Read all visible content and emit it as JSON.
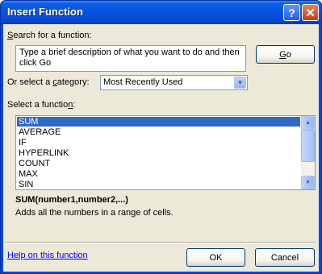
{
  "window": {
    "title": "Insert Function",
    "help_button": "?",
    "close_button": "✕"
  },
  "search": {
    "label_prefix": "",
    "label_accel": "S",
    "label_rest": "earch for a function:",
    "value": "Type a brief description of what you want to do and then click Go",
    "go_label_accel": "G",
    "go_label_rest": "o"
  },
  "category": {
    "label_prefix": "Or select a ",
    "label_accel": "c",
    "label_rest": "ategory:",
    "selected": "Most Recently Used"
  },
  "functions": {
    "label_prefix": "Select a functio",
    "label_accel": "n",
    "label_rest": ":",
    "items": [
      "SUM",
      "AVERAGE",
      "IF",
      "HYPERLINK",
      "COUNT",
      "MAX",
      "SIN"
    ],
    "selected_index": 0
  },
  "details": {
    "signature": "SUM(number1,number2,...)",
    "description": "Adds all the numbers in a range of cells."
  },
  "footer": {
    "help_link": "Help on this function",
    "ok_label": "OK",
    "cancel_label": "Cancel"
  },
  "colors": {
    "title_bar": "#0a52de",
    "selection": "#316ac5",
    "dialog_face": "#ece9d8",
    "link": "#0000ff"
  }
}
